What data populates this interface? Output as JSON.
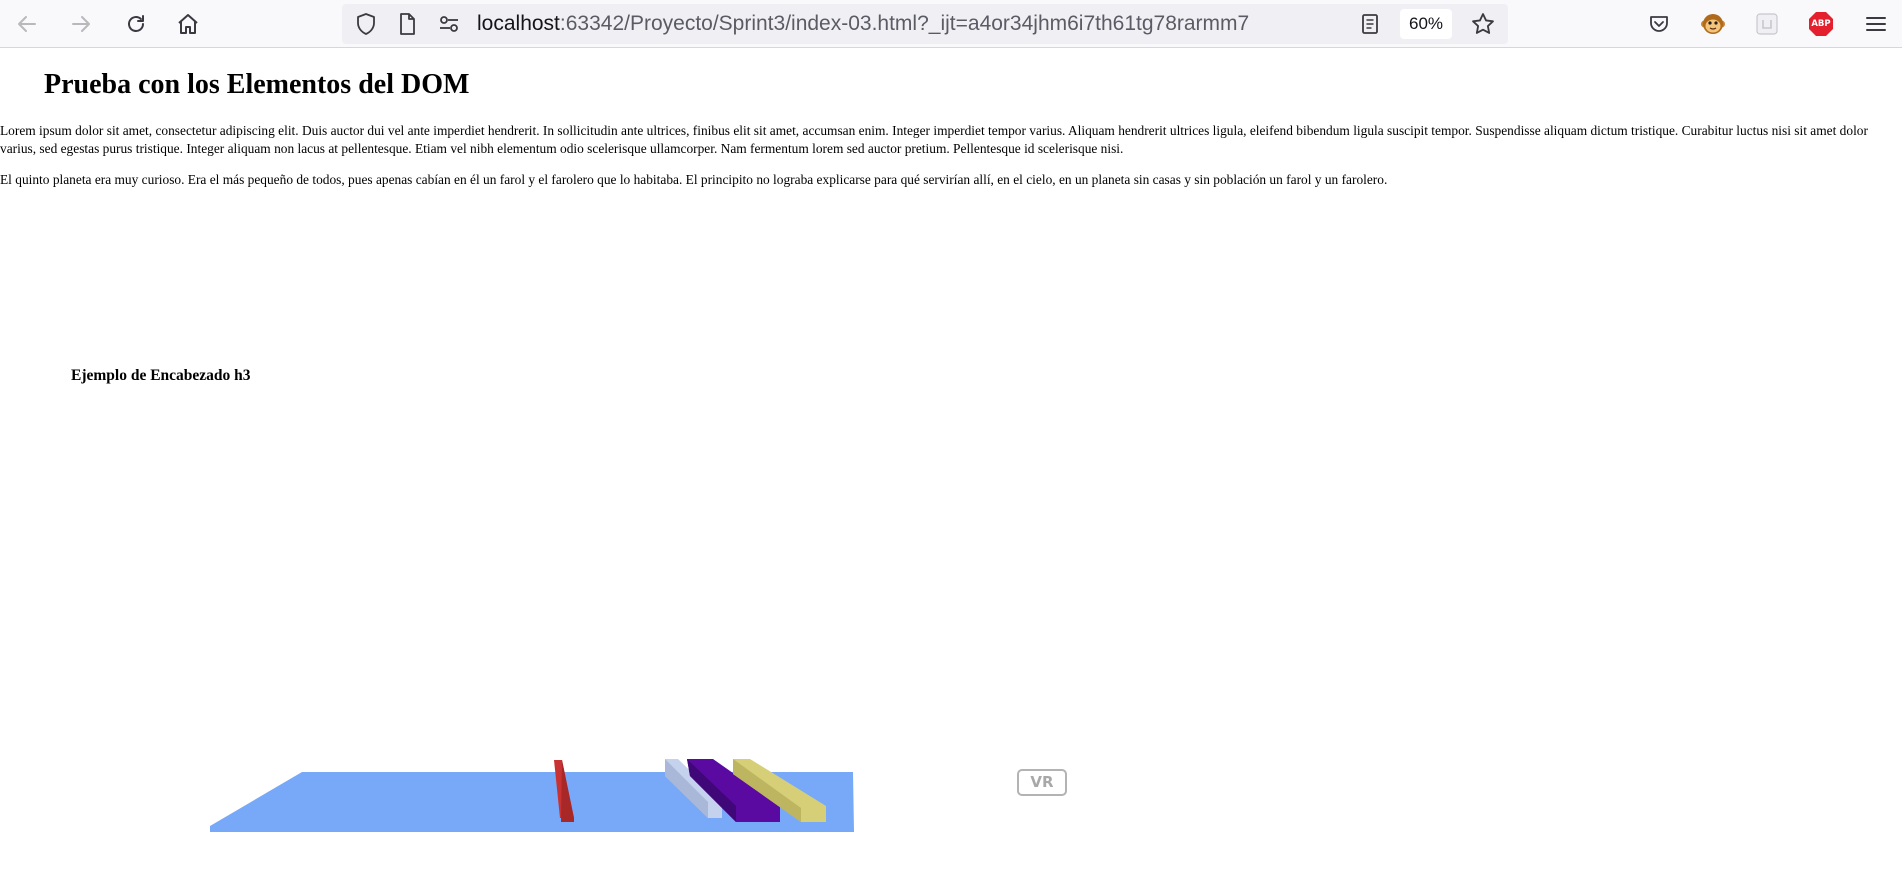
{
  "browser": {
    "nav": {
      "back_icon": "arrow-left-icon",
      "forward_icon": "arrow-right-icon",
      "reload_icon": "reload-icon",
      "home_icon": "home-icon"
    },
    "url": {
      "host": "localhost",
      "rest": ":63342/Proyecto/Sprint3/index-03.html?_ijt=a4or34jhm6i7th61tg78rarmm7"
    },
    "zoom": "60%",
    "extensions": {
      "abp_label": "ABP"
    }
  },
  "page": {
    "title": "Prueba con los Elementos del DOM",
    "paragraph_1": "Lorem ipsum dolor sit amet, consectetur adipiscing elit. Duis auctor dui vel ante imperdiet hendrerit. In sollicitudin ante ultrices, finibus elit sit amet, accumsan enim. Integer imperdiet tempor varius. Aliquam hendrerit ultrices ligula, eleifend bibendum ligula suscipit tempor. Suspendisse aliquam dictum tristique. Curabitur luctus nisi sit amet dolor varius, sed egestas purus tristique. Integer aliquam non lacus at pellentesque. Etiam vel nibh elementum odio scelerisque ullamcorper. Nam fermentum lorem sed auctor pretium. Pellentesque id scelerisque nisi.",
    "paragraph_2": "El quinto planeta era muy curioso. Era el más pequeño de todos, pues apenas cabían en él un farol y el farolero que lo habitaba. El principito no lograba explicarse para qué servirían allí, en el cielo, en un planeta sin casas y sin población un farol y un farolero.",
    "subheading": "Ejemplo de Encabezado h3",
    "vr_button": "VR"
  },
  "colors": {
    "floor": "#78a8f8",
    "red_bar": "#c83232",
    "light_bar": "#c4d2ee",
    "purple_bar": "#5a0aa0",
    "yellow_bar": "#d7cf78"
  }
}
